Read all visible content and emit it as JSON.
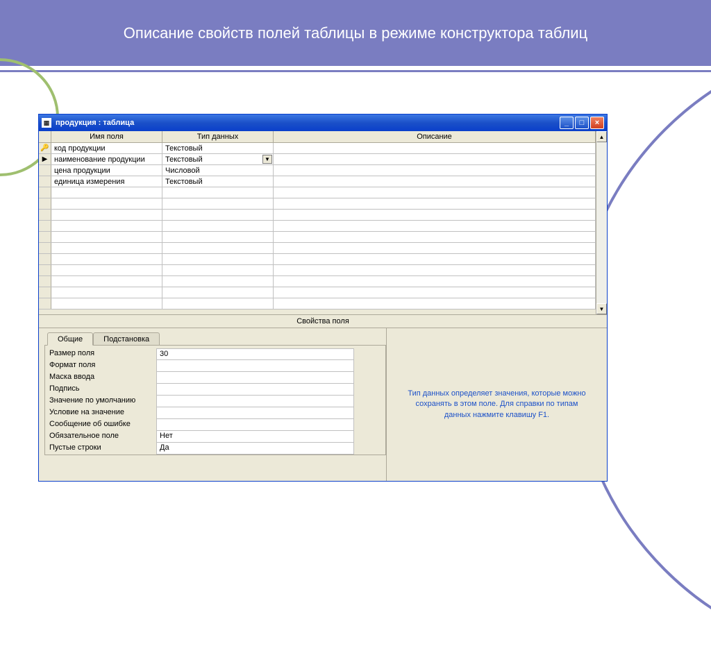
{
  "slide": {
    "title": "Описание свойств полей таблицы в режиме конструктора таблиц"
  },
  "window": {
    "title": "продукция : таблица",
    "minimize": "_",
    "maximize": "□",
    "close": "×"
  },
  "grid": {
    "headers": {
      "field_name": "Имя поля",
      "data_type": "Тип данных",
      "description": "Описание"
    },
    "rows": [
      {
        "selector": "key",
        "name": "код продукции",
        "type": "Текстовый",
        "desc": ""
      },
      {
        "selector": "current",
        "name": "наименование продукции",
        "type": "Текстовый",
        "desc": "",
        "dropdown": true
      },
      {
        "selector": "",
        "name": "цена продукции",
        "type": "Числовой",
        "desc": ""
      },
      {
        "selector": "",
        "name": "единица измерения",
        "type": "Текстовый",
        "desc": ""
      }
    ],
    "empty_rows": 11
  },
  "props": {
    "section_label": "Свойства поля",
    "tabs": {
      "general": "Общие",
      "lookup": "Подстановка"
    },
    "rows": [
      {
        "label": "Размер поля",
        "value": "30"
      },
      {
        "label": "Формат поля",
        "value": ""
      },
      {
        "label": "Маска ввода",
        "value": ""
      },
      {
        "label": "Подпись",
        "value": ""
      },
      {
        "label": "Значение по умолчанию",
        "value": ""
      },
      {
        "label": "Условие на значение",
        "value": ""
      },
      {
        "label": "Сообщение об ошибке",
        "value": ""
      },
      {
        "label": "Обязательное поле",
        "value": "Нет"
      },
      {
        "label": "Пустые строки",
        "value": "Да"
      }
    ],
    "help_text": "Тип данных определяет значения, которые можно сохранять в этом поле.  Для справки по типам данных нажмите клавишу F1."
  }
}
